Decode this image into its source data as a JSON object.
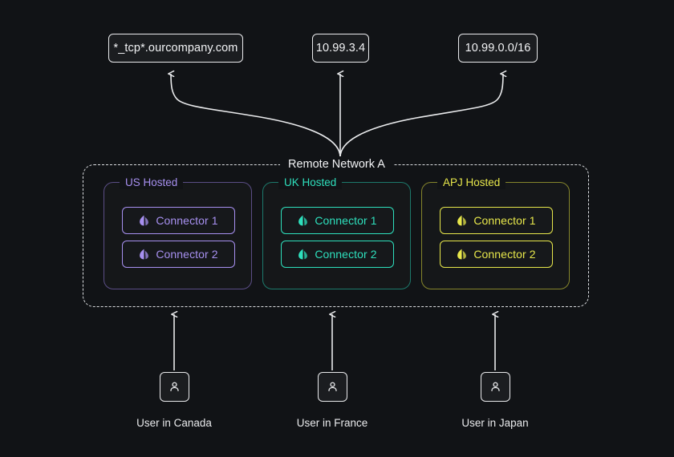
{
  "diagram": {
    "title": "Remote Network A",
    "background_color": "#111316",
    "line_color": "#e9eaec"
  },
  "destinations": [
    {
      "label": "*_tcp*.ourcompany.com",
      "name": "destination-dns-wildcard"
    },
    {
      "label": "10.99.3.4",
      "name": "destination-host-ip"
    },
    {
      "label": "10.99.0.0/16",
      "name": "destination-cidr"
    }
  ],
  "remote_network": {
    "label": "Remote Network A",
    "groups": [
      {
        "label": "US Hosted",
        "accent": "#a790f0",
        "border": "#5b4e86",
        "connectors": [
          {
            "label": "Connector 1",
            "icon": "leaf-icon"
          },
          {
            "label": "Connector 2",
            "icon": "leaf-icon"
          }
        ]
      },
      {
        "label": "UK Hosted",
        "accent": "#2ee0bd",
        "border": "#1d7a6c",
        "connectors": [
          {
            "label": "Connector 1",
            "icon": "leaf-icon"
          },
          {
            "label": "Connector 2",
            "icon": "leaf-icon"
          }
        ]
      },
      {
        "label": "APJ Hosted",
        "accent": "#e7e74b",
        "border": "#86862c",
        "connectors": [
          {
            "label": "Connector 1",
            "icon": "leaf-icon"
          },
          {
            "label": "Connector 2",
            "icon": "leaf-icon"
          }
        ]
      }
    ]
  },
  "users": [
    {
      "label": "User in Canada",
      "icon": "user-icon"
    },
    {
      "label": "User in France",
      "icon": "user-icon"
    },
    {
      "label": "User in Japan",
      "icon": "user-icon"
    }
  ]
}
